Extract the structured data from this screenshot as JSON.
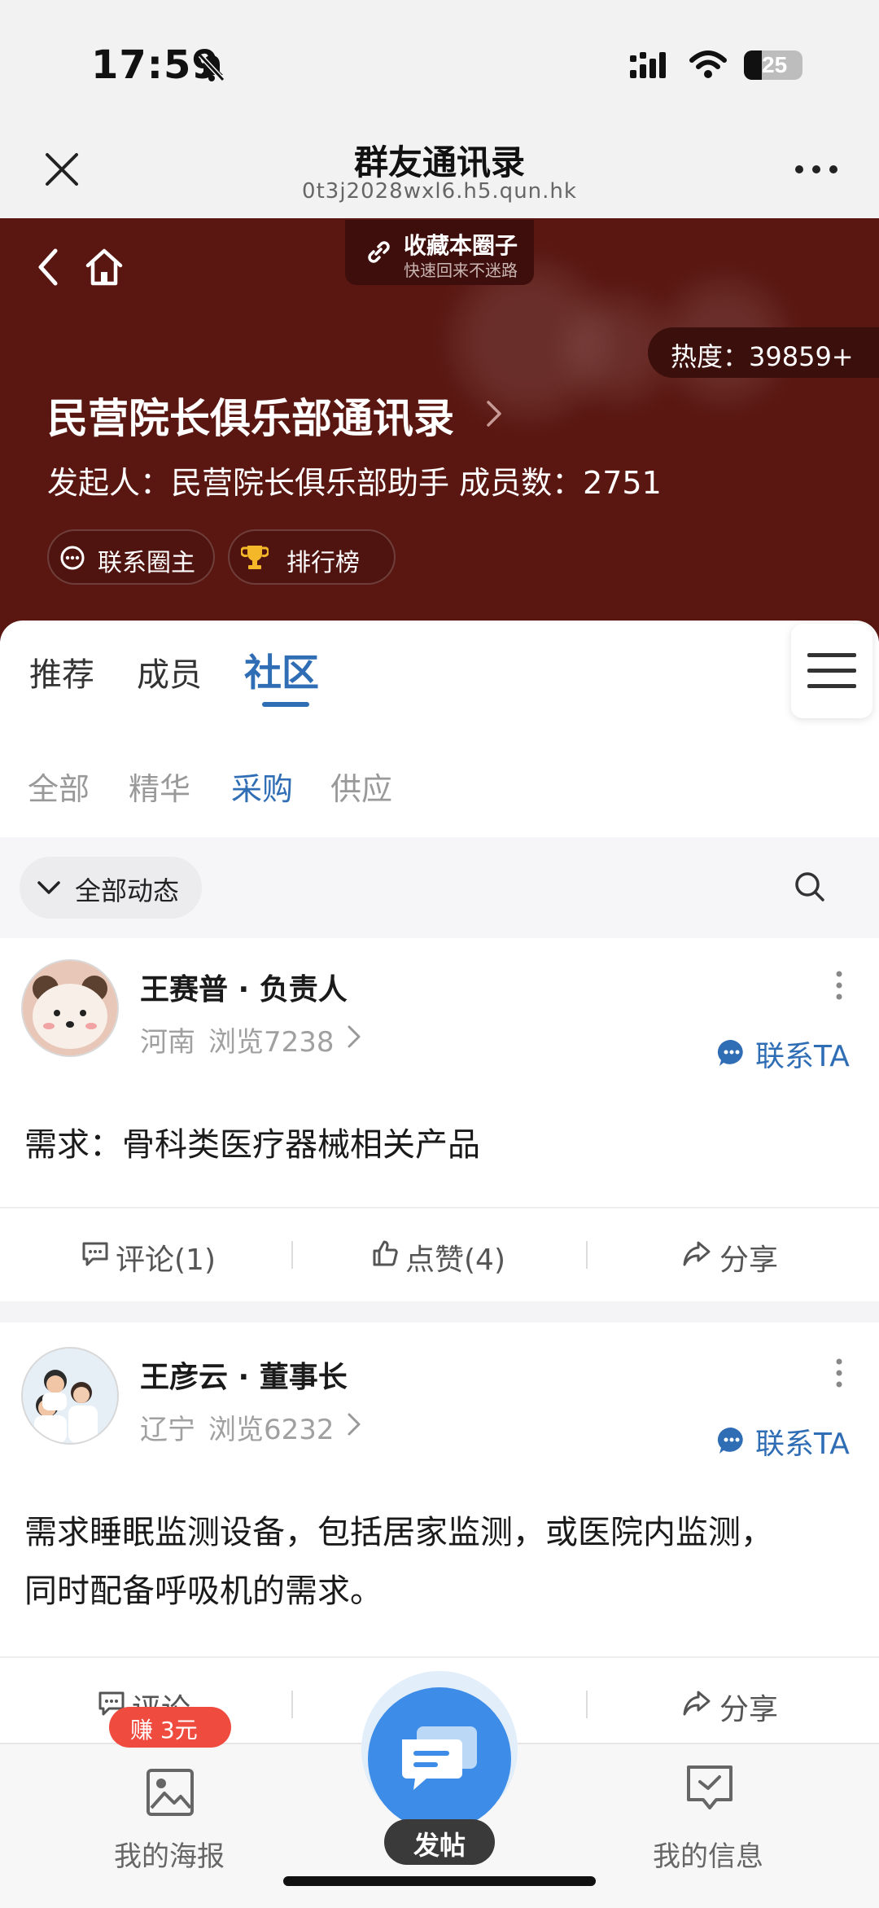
{
  "status_bar": {
    "time": "17:59",
    "battery": "25",
    "icons": [
      "bell-muted-icon",
      "signal-icon",
      "wifi-icon",
      "battery-icon"
    ]
  },
  "nav": {
    "title": "群友通讯录",
    "url": "0t3j2028wxl6.h5.qun.hk",
    "close_icon": "close-icon",
    "more_icon": "more-icon"
  },
  "header": {
    "favorite": {
      "title": "收藏本圈子",
      "subtitle": "快速回来不迷路"
    },
    "heat": "热度：39859+",
    "club_title": "民营院长俱乐部通讯录",
    "club_info": "发起人：民营院长俱乐部助手    成员数：2751",
    "buttons": [
      {
        "label": "联系圈主",
        "icon": "chat-icon"
      },
      {
        "label": "排行榜",
        "icon": "trophy-icon"
      }
    ]
  },
  "tabs": [
    "推荐",
    "成员",
    "社区"
  ],
  "active_tab": "社区",
  "subtabs": [
    "全部",
    "精华",
    "采购",
    "供应"
  ],
  "active_subtab": "采购",
  "filter": {
    "label": "全部动态"
  },
  "posts": [
    {
      "name": "王赛普 · 负责人",
      "location": "河南",
      "views": "浏览7238",
      "contact": "联系TA",
      "body": "需求：骨科类医疗器械相关产品",
      "actions": {
        "comment": "评论(1)",
        "like": "点赞(4)",
        "share": "分享"
      }
    },
    {
      "name": "王彦云 · 董事长",
      "location": "辽宁",
      "views": "浏览6232",
      "contact": "联系TA",
      "body_lines": [
        "需求睡眠监测设备，包括居家监测，或医院内监测，",
        "同时配备呼吸机的需求。"
      ],
      "actions": {
        "comment": "评论",
        "share": "分享"
      }
    }
  ],
  "bottom_bar": {
    "earn_badge": "赚 3元",
    "poster_label": "我的海报",
    "post_label": "发帖",
    "info_label": "我的信息"
  },
  "colors": {
    "header_bg": "#5a1712",
    "accent": "#2f6db5",
    "fab": "#3c8ce8",
    "badge": "#ef4b3f"
  }
}
